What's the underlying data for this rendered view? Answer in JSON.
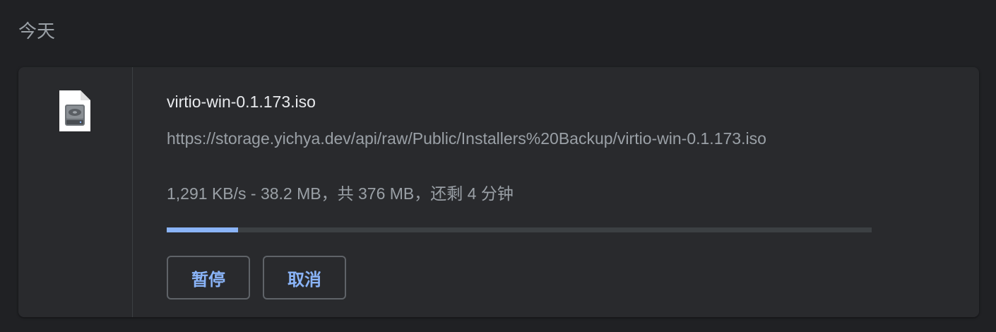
{
  "section": {
    "date_label": "今天"
  },
  "download": {
    "file_icon": "disk-image-file-icon",
    "file_name": "virtio-win-0.1.173.iso",
    "url": "https://storage.yichya.dev/api/raw/Public/Installers%20Backup/virtio-win-0.1.173.iso",
    "status_text": "1,291 KB/s - 38.2 MB，共 376 MB，还剩 4 分钟",
    "progress_fraction": 0.1016
  },
  "actions": {
    "pause_label": "暂停",
    "cancel_label": "取消"
  },
  "colors": {
    "background": "#202124",
    "card": "#292a2d",
    "accent": "#8ab4f8",
    "text_primary": "#e8eaed",
    "text_secondary": "#9aa0a6"
  }
}
